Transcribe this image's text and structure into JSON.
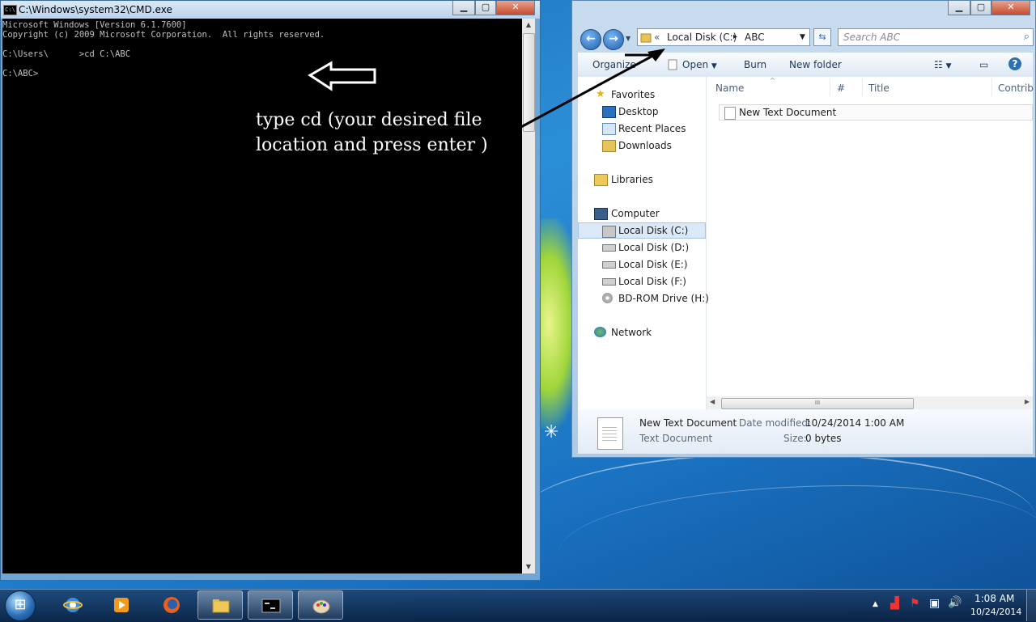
{
  "cmd": {
    "title": "C:\\Windows\\system32\\CMD.exe",
    "title_icon": "C:\\",
    "lines": [
      "Microsoft Windows [Version 6.1.7600]",
      "Copyright (c) 2009 Microsoft Corporation.  All rights reserved.",
      "",
      "C:\\Users\\      >cd C:\\ABC",
      "",
      "C:\\ABC>"
    ],
    "annotation": "type cd (your desired file location  and press enter )"
  },
  "explorer": {
    "address": {
      "chevrons": "«",
      "segment1": "Local Disk (C:)",
      "separator": "▸",
      "segment2": "ABC"
    },
    "search_placeholder": "Search ABC",
    "toolbar": {
      "organize": "Organize",
      "open": "Open",
      "burn": "Burn",
      "new_folder": "New folder"
    },
    "nav": {
      "favorites": "Favorites",
      "desktop": "Desktop",
      "recent": "Recent Places",
      "downloads": "Downloads",
      "libraries": "Libraries",
      "computer": "Computer",
      "disk_c": "Local Disk (C:)",
      "disk_d": "Local Disk (D:)",
      "disk_e": "Local Disk (E:)",
      "disk_f": "Local Disk (F:)",
      "bd": "BD-ROM Drive (H:)",
      "network": "Network"
    },
    "columns": {
      "name": "Name",
      "num": "#",
      "title": "Title",
      "contrib": "Contrib"
    },
    "file": "New Text Document",
    "scroll_grip": "III",
    "details": {
      "name": "New Text Document",
      "type": "Text Document",
      "modified_label": "Date modified:",
      "modified_value": "10/24/2014 1:00 AM",
      "size_label": "Size:",
      "size_value": "0 bytes"
    }
  },
  "taskbar": {
    "time": "1:08 AM",
    "date": "10/24/2014"
  }
}
